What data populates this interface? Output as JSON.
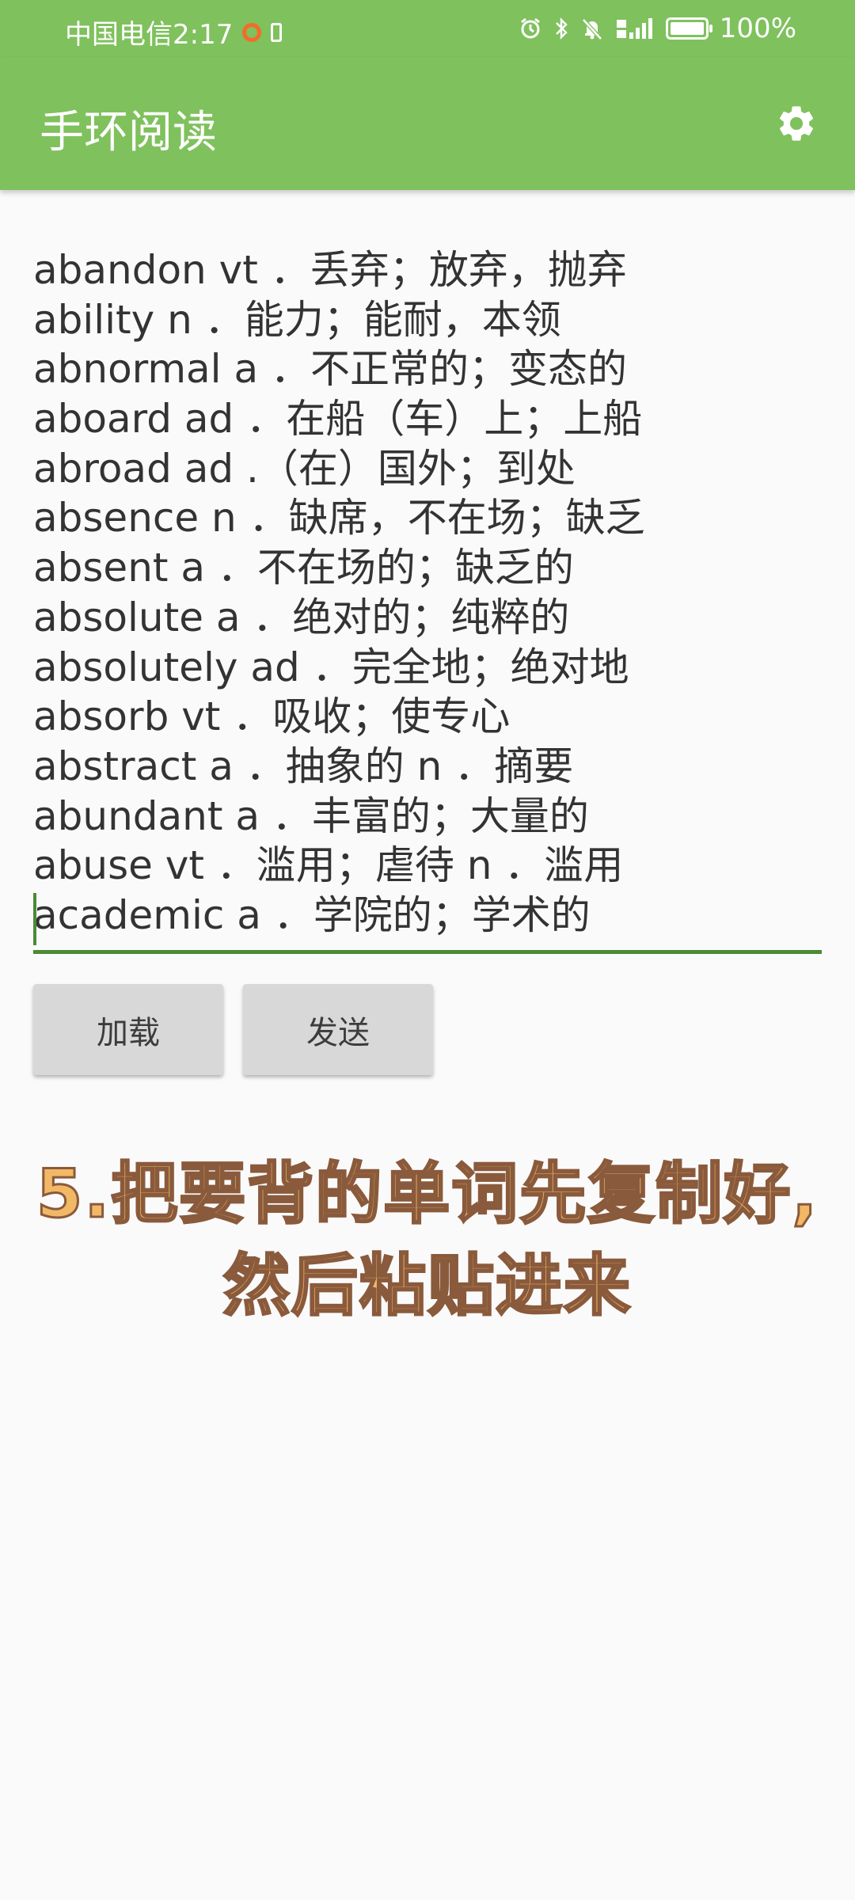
{
  "status_bar": {
    "carrier_time": "中国电信2:17",
    "battery_level": "100%",
    "battery_fraction": 1.0
  },
  "app_bar": {
    "title": "手环阅读",
    "settings_icon": "gear-icon"
  },
  "editor": {
    "lines": [
      "abandon vt ．丢弃；放弃，抛弃",
      "ability n ．能力；能耐，本领",
      "abnormal a ．不正常的；变态的",
      "aboard ad ．在船（车）上；上船",
      "abroad ad .（在）国外；到处",
      "absence n ．缺席，不在场；缺乏",
      "absent a ．不在场的；缺乏的",
      "absolute a ．绝对的；纯粹的",
      "absolutely ad ．完全地；绝对地",
      "absorb vt ．吸收；使专心",
      "abstract a ．抽象的 n ．摘要",
      "abundant a ．丰富的；大量的",
      "abuse vt ．滥用；虐待 n ．滥用",
      "academic a ．学院的；学术的"
    ]
  },
  "buttons": {
    "load": "加载",
    "send": "发送"
  },
  "caption": {
    "line1": "5.把要背的单词先复制好,",
    "line2": "然后粘贴进来"
  },
  "colors": {
    "app_bar": "#7fc15d",
    "accent": "#4d8a37",
    "caption_fill": "#f2b866",
    "caption_stroke": "#8a5a3c"
  }
}
